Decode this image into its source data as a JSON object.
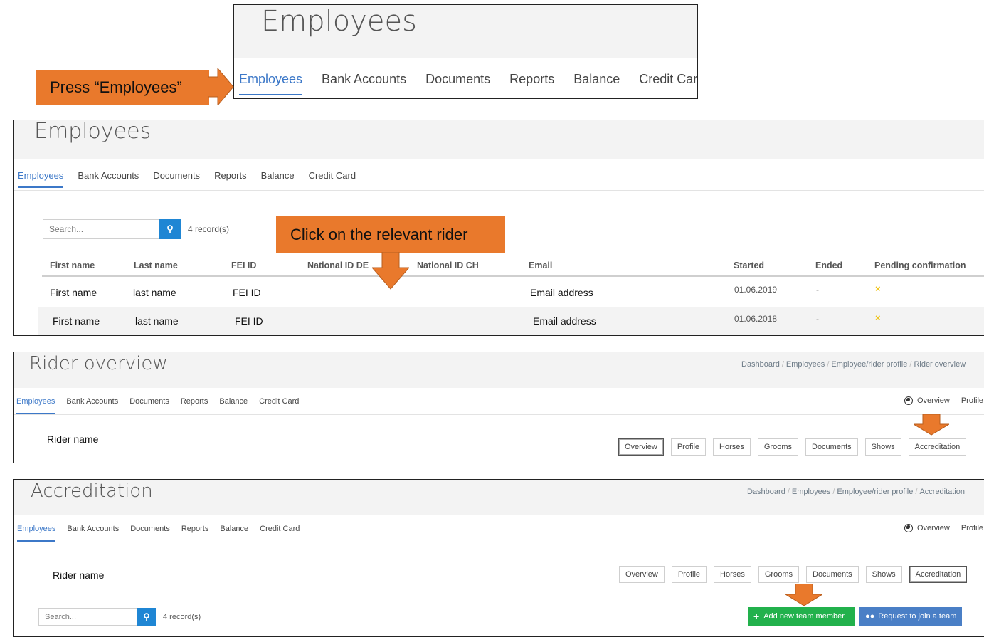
{
  "top_panel": {
    "title": "Employees",
    "tabs": [
      "Employees",
      "Bank Accounts",
      "Documents",
      "Reports",
      "Balance",
      "Credit Card"
    ]
  },
  "callout_press": "Press “Employees”",
  "employees_panel": {
    "title": "Employees",
    "tabs": [
      "Employees",
      "Bank Accounts",
      "Documents",
      "Reports",
      "Balance",
      "Credit Card"
    ],
    "search_placeholder": "Search...",
    "records": "4 record(s)",
    "columns": [
      "First name",
      "Last name",
      "FEI ID",
      "National ID DE",
      "National ID CH",
      "Email",
      "Started",
      "Ended",
      "Pending confirmation"
    ],
    "rows": [
      {
        "first": "First name",
        "last": "last name",
        "fei": "FEI ID",
        "email": "Email address",
        "started": "01.06.2019",
        "ended": "-",
        "pending": "×"
      },
      {
        "first": "First name",
        "last": "last name",
        "fei": "FEI ID",
        "email": "Email address",
        "started": "01.06.2018",
        "ended": "-",
        "pending": "×"
      }
    ]
  },
  "callout_click": "Click on the relevant rider",
  "rider_panel": {
    "title": "Rider overview",
    "breadcrumb": [
      "Dashboard",
      "Employees",
      "Employee/rider profile",
      "Rider overview"
    ],
    "tabs": [
      "Employees",
      "Bank Accounts",
      "Documents",
      "Reports",
      "Balance",
      "Credit Card"
    ],
    "right_nav": [
      "Overview",
      "Profile"
    ],
    "rider_name": "Rider name",
    "buttons": [
      "Overview",
      "Profile",
      "Horses",
      "Grooms",
      "Documents",
      "Shows",
      "Accreditation"
    ]
  },
  "accreditation_panel": {
    "title": "Accreditation",
    "breadcrumb": [
      "Dashboard",
      "Employees",
      "Employee/rider profile",
      "Accreditation"
    ],
    "tabs": [
      "Employees",
      "Bank Accounts",
      "Documents",
      "Reports",
      "Balance",
      "Credit Card"
    ],
    "right_nav": [
      "Overview",
      "Profile"
    ],
    "rider_name": "Rider name",
    "buttons": [
      "Overview",
      "Profile",
      "Horses",
      "Grooms",
      "Documents",
      "Shows",
      "Accreditation"
    ],
    "search_placeholder": "Search...",
    "records": "4 record(s)",
    "add_member": "Add new team member",
    "request_join": "Request to join a team"
  },
  "colors": {
    "accent": "#3c78c8",
    "callout": "#e9792c",
    "green": "#22b14c",
    "blue_btn": "#4a7fc6",
    "warning_x": "#f0c419"
  }
}
